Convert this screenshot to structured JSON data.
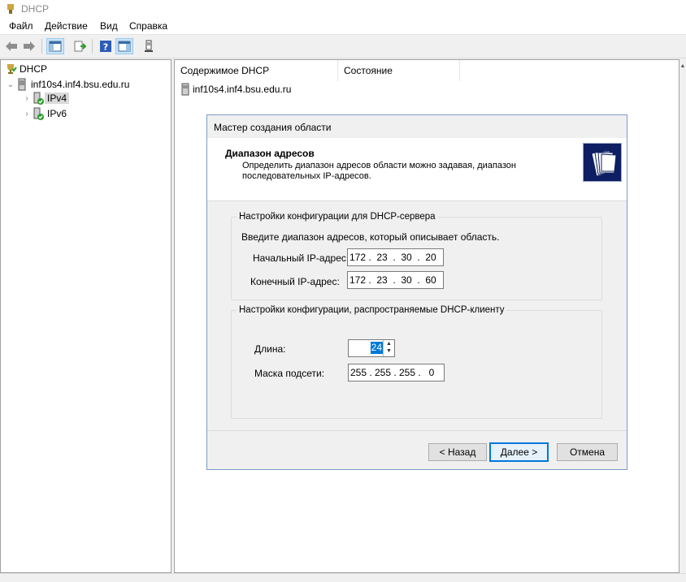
{
  "window": {
    "title": "DHCP"
  },
  "menu": [
    "Файл",
    "Действие",
    "Вид",
    "Справка"
  ],
  "tree": {
    "root": "DHCP",
    "server": "inf10s4.inf4.bsu.edu.ru",
    "ipv4": "IPv4",
    "ipv6": "IPv6"
  },
  "content": {
    "col_contents": "Содержимое DHCP",
    "col_status": "Состояние",
    "row_server": "inf10s4.inf4.bsu.edu.ru"
  },
  "wizard": {
    "title": "Мастер создания области",
    "header_title": "Диапазон адресов",
    "header_desc": "Определить диапазон адресов области можно задавая, диапазон последовательных IP-адресов.",
    "group1_legend": "Настройки конфигурации для DHCP-сервера",
    "group1_hint": "Введите диапазон адресов, который описывает область.",
    "start_ip_label": "Начальный IP-адрес:",
    "start_ip": [
      "172",
      "23",
      "30",
      "20"
    ],
    "end_ip_label": "Конечный IP-адрес:",
    "end_ip": [
      "172",
      "23",
      "30",
      "60"
    ],
    "group2_legend": "Настройки конфигурации, распространяемые DHCP-клиенту",
    "length_label": "Длина:",
    "length_value": "24",
    "mask_label": "Маска подсети:",
    "mask": [
      "255",
      "255",
      "255",
      "0"
    ],
    "btn_back": "< Назад",
    "btn_next": "Далее >",
    "btn_cancel": "Отмена"
  },
  "colors": {
    "accent": "#0078d7",
    "wizard_border": "#7a9cc9",
    "selection": "#d9d9d9"
  }
}
